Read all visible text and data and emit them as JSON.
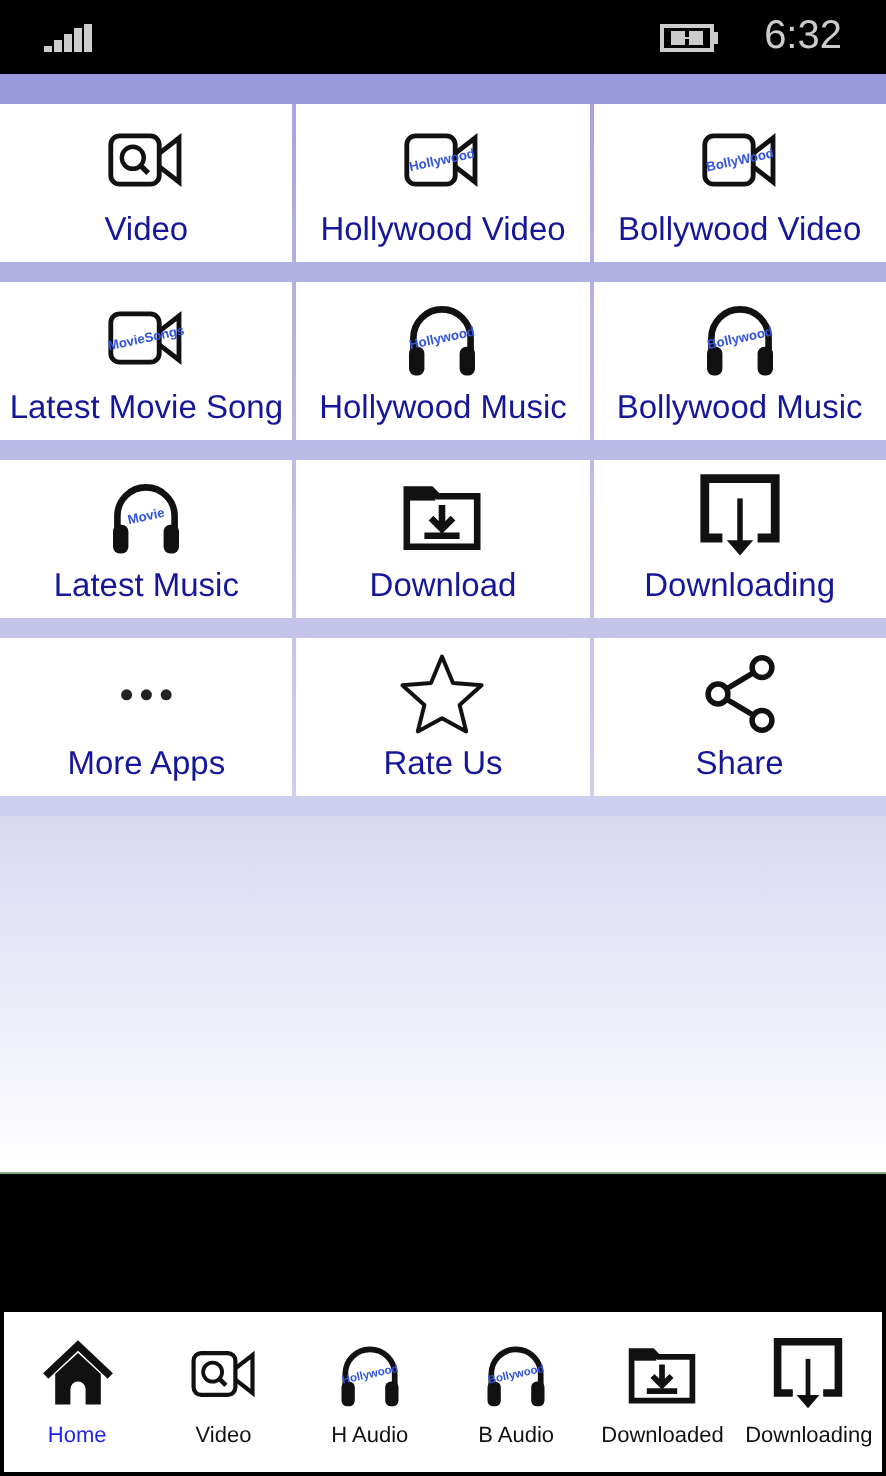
{
  "status_bar": {
    "time": "6:32"
  },
  "tiles": [
    {
      "label": "Video",
      "kind": "camera-search"
    },
    {
      "label": "Hollywood Video",
      "kind": "camera",
      "icon_text": "Hollywood"
    },
    {
      "label": "Bollywood Video",
      "kind": "camera",
      "icon_text": "BollyWood"
    },
    {
      "label": "Latest Movie Song",
      "kind": "camera",
      "icon_text": "MovieSongs"
    },
    {
      "label": "Hollywood Music",
      "kind": "headphones",
      "icon_text": "Hollywood"
    },
    {
      "label": "Bollywood Music",
      "kind": "headphones",
      "icon_text": "Bollywood"
    },
    {
      "label": "Latest Music",
      "kind": "headphones",
      "icon_text": "Movie"
    },
    {
      "label": "Download",
      "kind": "folder-download"
    },
    {
      "label": "Downloading",
      "kind": "tray-download"
    },
    {
      "label": "More Apps",
      "kind": "dots"
    },
    {
      "label": "Rate Us",
      "kind": "star"
    },
    {
      "label": "Share",
      "kind": "share"
    }
  ],
  "bottom_nav": [
    {
      "label": "Home",
      "kind": "home",
      "selected": true
    },
    {
      "label": "Video",
      "kind": "camera-search",
      "selected": false
    },
    {
      "label": "H Audio",
      "kind": "headphones",
      "icon_text": "Hollywood",
      "selected": false
    },
    {
      "label": "B Audio",
      "kind": "headphones",
      "icon_text": "Bollywood",
      "selected": false
    },
    {
      "label": "Downloaded",
      "kind": "folder-download",
      "selected": false
    },
    {
      "label": "Downloading",
      "kind": "tray-download",
      "selected": false
    }
  ]
}
